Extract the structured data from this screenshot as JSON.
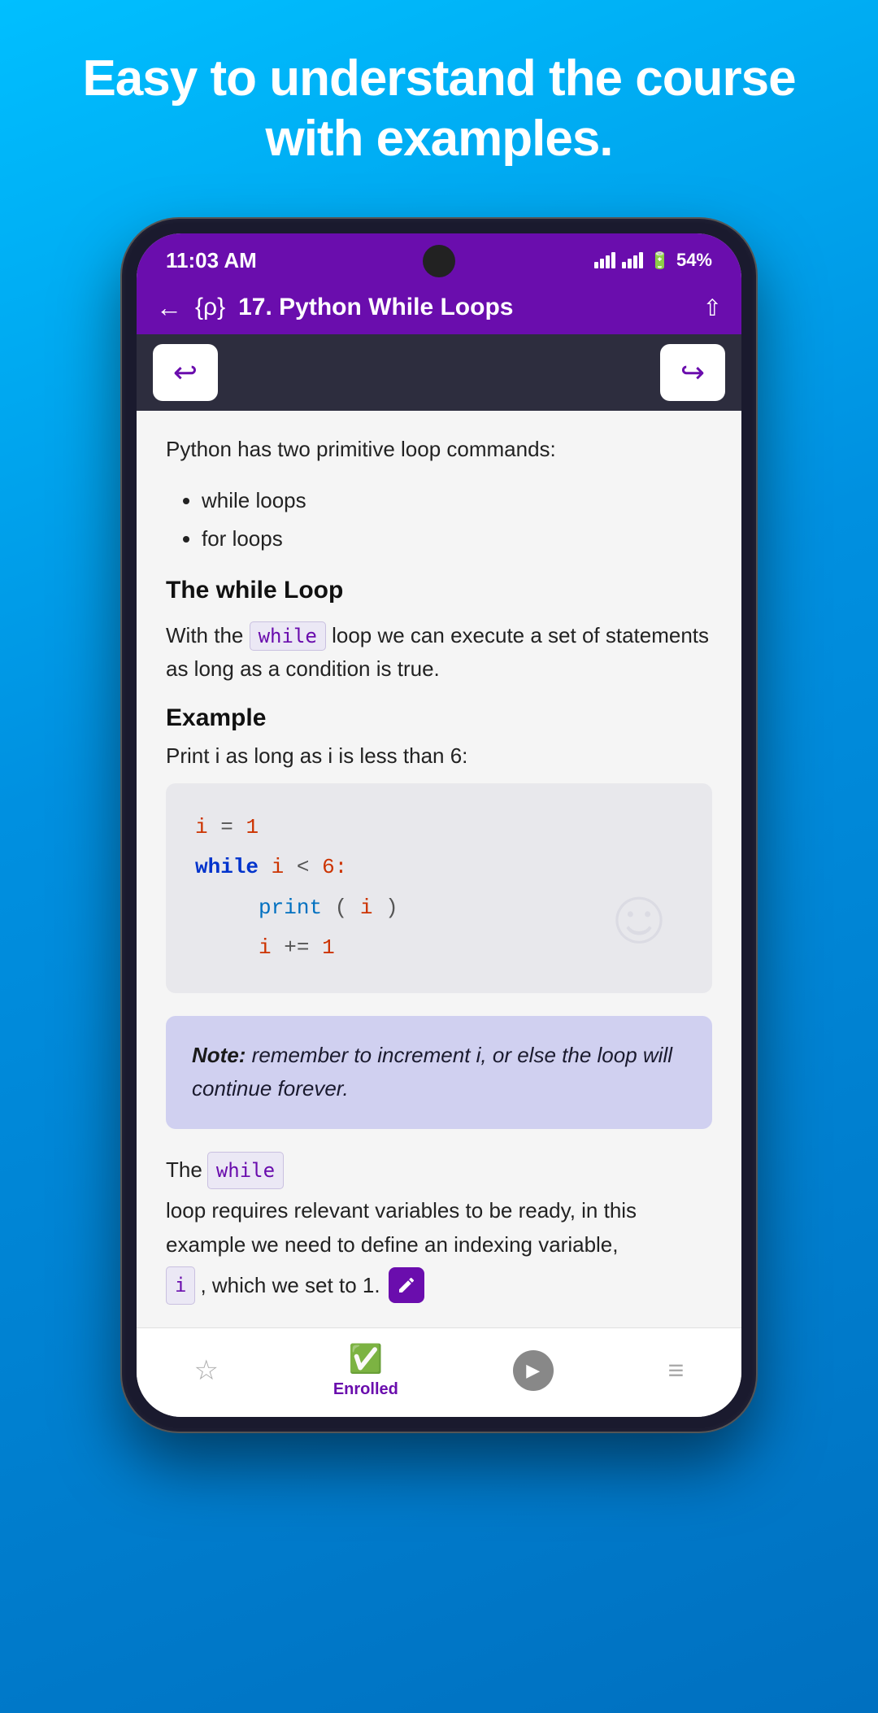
{
  "page": {
    "hero_title": "Easy to understand the course with examples.",
    "background_gradient_start": "#00bfff",
    "background_gradient_end": "#0070c0"
  },
  "phone": {
    "status_bar": {
      "time": "11:03 AM",
      "battery_percent": "54%"
    },
    "nav_bar": {
      "title": "17. Python While Loops",
      "back_label": "back",
      "share_label": "share"
    },
    "content": {
      "intro": "Python has two primitive loop commands:",
      "bullets": [
        "while loops",
        "for loops"
      ],
      "while_loop_heading": "The while Loop",
      "while_loop_desc_before": "With the",
      "while_keyword": "while",
      "while_loop_desc_after": "loop we can execute a set of statements as long as a condition is true.",
      "example_label": "Example",
      "example_desc": "Print i as long as i is less than 6:",
      "code_lines": [
        {
          "text": "i = 1",
          "parts": [
            {
              "t": "var",
              "v": "i"
            },
            {
              "t": "op",
              "v": " = "
            },
            {
              "t": "num",
              "v": "1"
            }
          ]
        },
        {
          "text": "while i < 6:",
          "parts": [
            {
              "t": "kw",
              "v": "while"
            },
            {
              "t": "op",
              "v": " "
            },
            {
              "t": "var",
              "v": "i"
            },
            {
              "t": "op",
              "v": " < "
            },
            {
              "t": "num",
              "v": "6:"
            }
          ]
        },
        {
          "text": "    print(i)",
          "parts": [
            {
              "t": "indent",
              "v": "    "
            },
            {
              "t": "func",
              "v": "print"
            },
            {
              "t": "op",
              "v": "("
            },
            {
              "t": "var",
              "v": "i"
            },
            {
              "t": "op",
              "v": ")"
            }
          ]
        },
        {
          "text": "    i += 1",
          "parts": [
            {
              "t": "indent",
              "v": "    "
            },
            {
              "t": "var",
              "v": "i"
            },
            {
              "t": "op",
              "v": " += "
            },
            {
              "t": "num",
              "v": "1"
            }
          ]
        }
      ],
      "note_bold": "Note:",
      "note_text": " remember to increment i, or else the loop will continue forever.",
      "bottom_desc_before": "The",
      "bottom_while_keyword": "while",
      "bottom_desc_middle": "loop requires relevant variables to be ready, in this example we need to define an indexing variable,",
      "bottom_i_keyword": "i",
      "bottom_desc_end": ", which we set to 1."
    },
    "tab_bar": {
      "star_label": "",
      "enrolled_label": "Enrolled",
      "play_label": "",
      "menu_label": ""
    }
  }
}
